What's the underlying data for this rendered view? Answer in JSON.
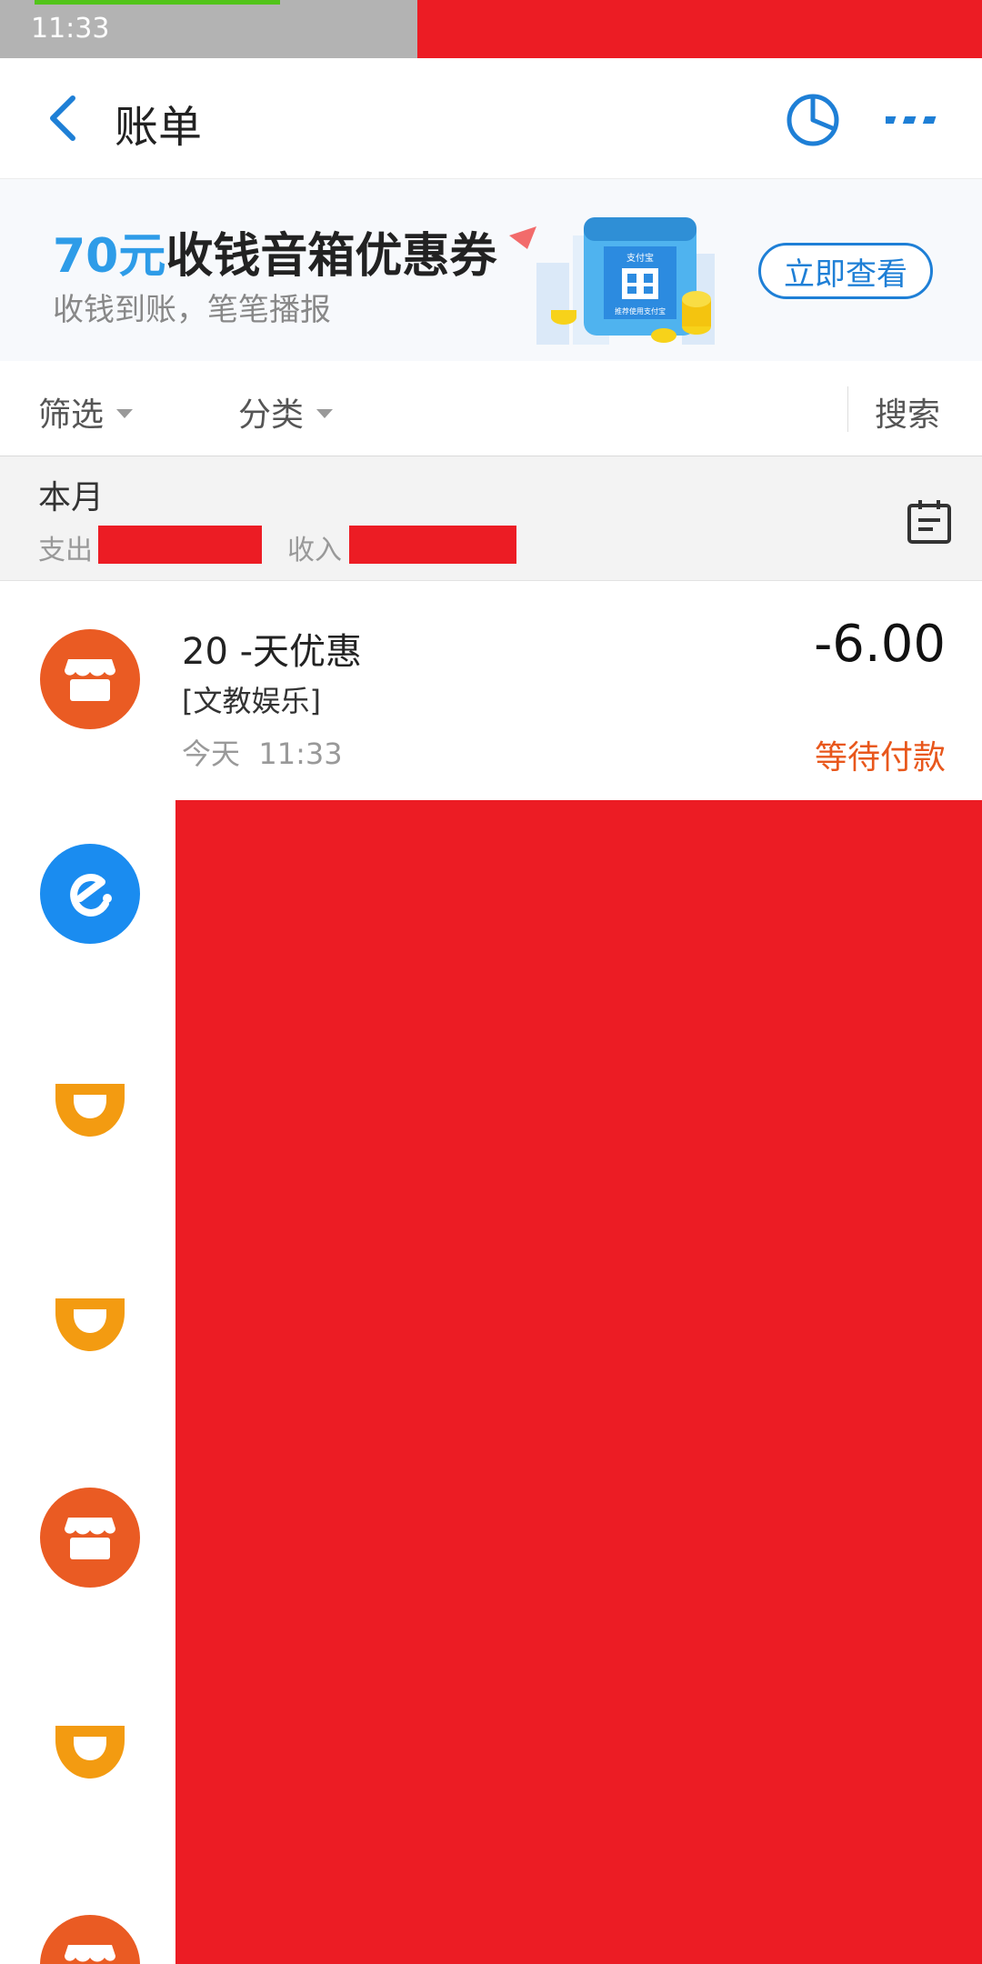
{
  "status_bar": {
    "time": "11:33"
  },
  "header": {
    "title": "账单"
  },
  "banner": {
    "title_accent": "70元",
    "title_rest": "收钱音箱优惠券",
    "subtitle": "收钱到账，笔笔播报",
    "cta_label": "立即查看",
    "art_brand": "支付宝",
    "art_caption": "推荐使用支付宝"
  },
  "filters": {
    "filter_label": "筛选",
    "category_label": "分类",
    "search_label": "搜索"
  },
  "summary": {
    "period": "本月",
    "expense_label": "支出",
    "income_label": "收入"
  },
  "transactions": [
    {
      "icon": "shop-icon",
      "title": "20 -天优惠",
      "category": "[文教娱乐]",
      "date": "今天",
      "time": "11:33",
      "amount": "-6.00",
      "status": "等待付款"
    }
  ],
  "list_icons": [
    "eleme-icon",
    "didi-icon",
    "didi-icon",
    "shop-icon",
    "didi-icon",
    "shop-icon"
  ],
  "colors": {
    "accent_blue": "#1e7fd6",
    "redaction_red": "#ec1c24",
    "status_orange": "#e8571c",
    "shop_orange": "#ea5b23",
    "eleme_blue": "#1a8cf0",
    "didi_orange": "#f39b11"
  }
}
